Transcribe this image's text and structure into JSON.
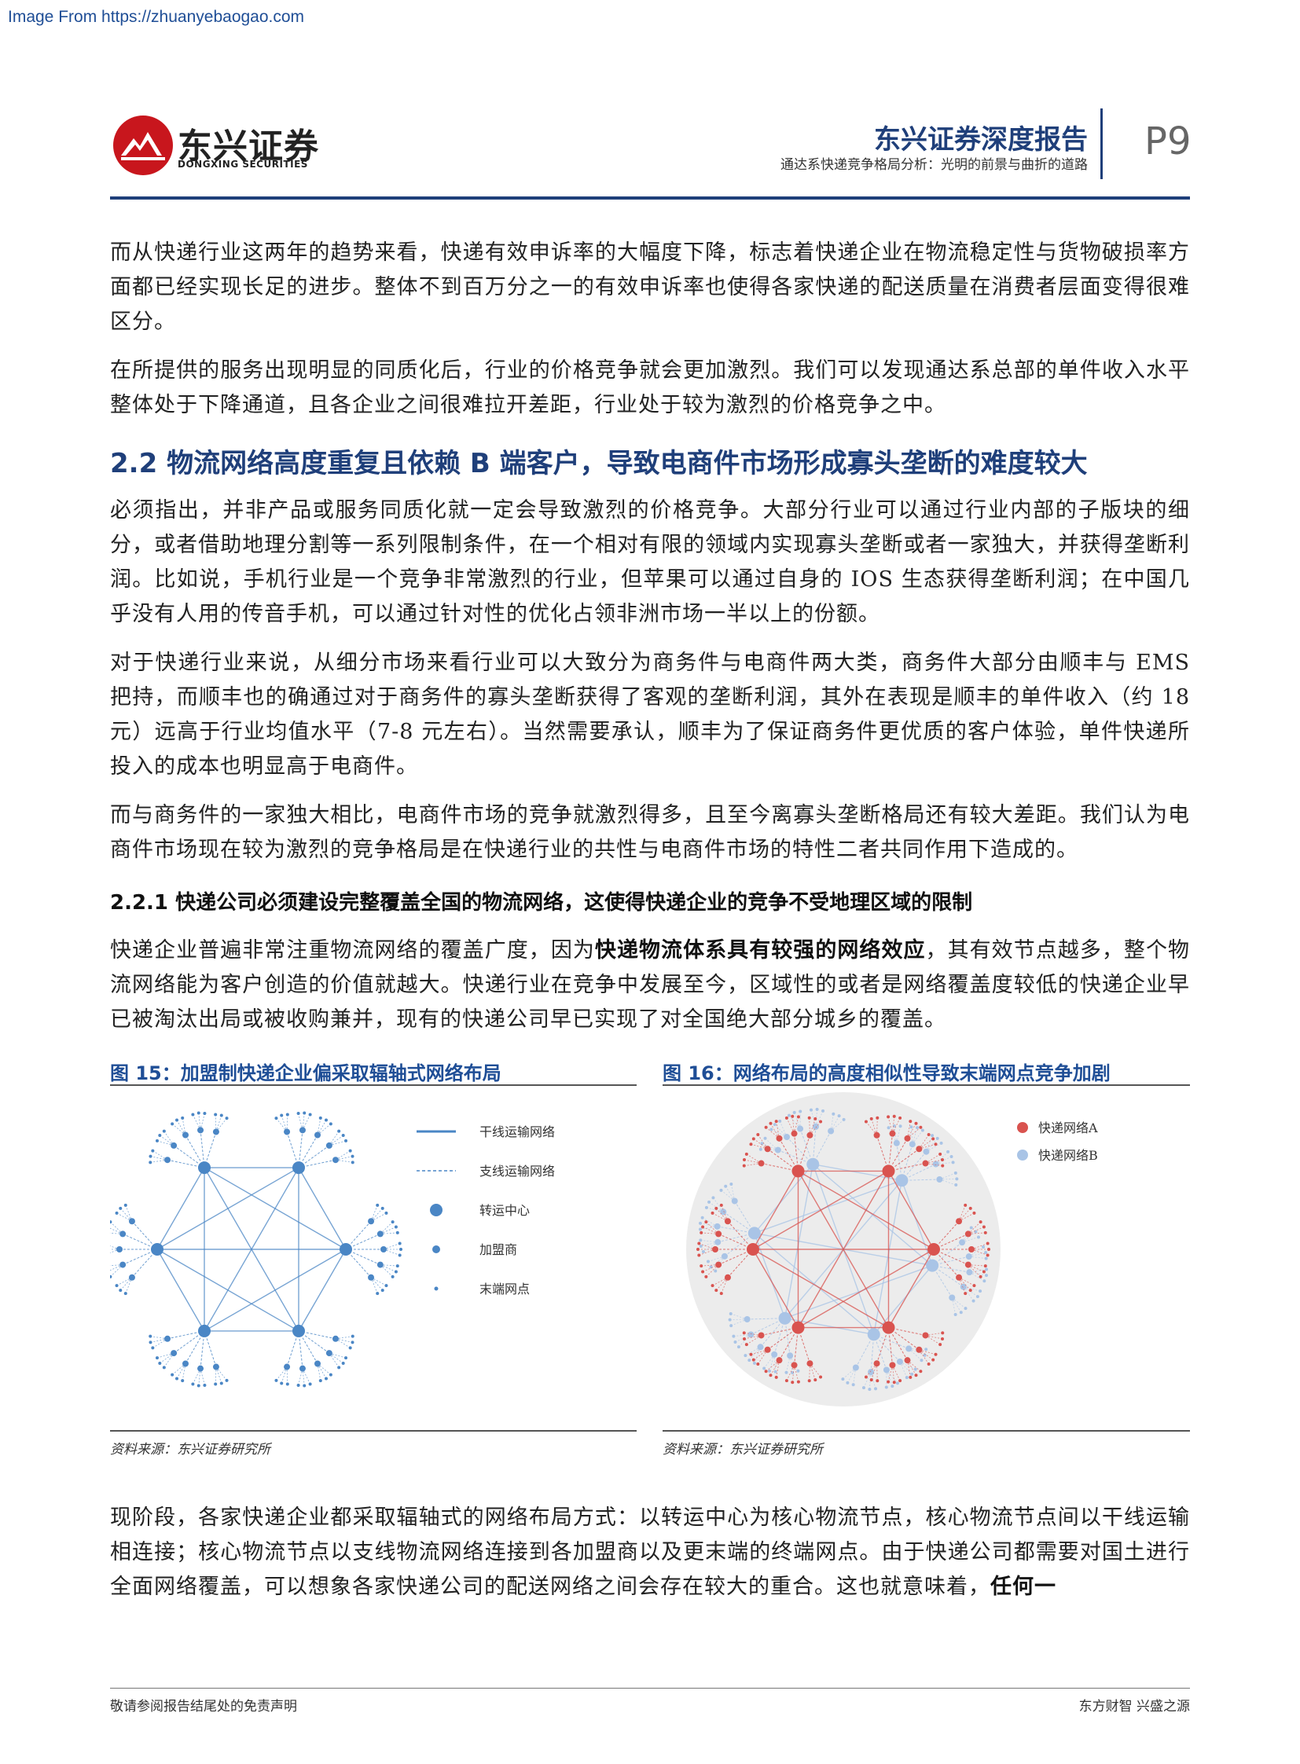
{
  "source_url": "Image From https://zhuanyebaogao.com",
  "header": {
    "logo_cn": "东兴证券",
    "logo_en": "DONGXING SECURITIES",
    "report_title": "东兴证券深度报告",
    "report_subtitle": "通达系快递竞争格局分析：光明的前景与曲折的道路",
    "page": "P9"
  },
  "body": {
    "p1": "而从快递行业这两年的趋势来看，快递有效申诉率的大幅度下降，标志着快递企业在物流稳定性与货物破损率方面都已经实现长足的进步。整体不到百万分之一的有效申诉率也使得各家快递的配送质量在消费者层面变得很难区分。",
    "p2": "在所提供的服务出现明显的同质化后，行业的价格竞争就会更加激烈。我们可以发现通达系总部的单件收入水平整体处于下降通道，且各企业之间很难拉开差距，行业处于较为激烈的价格竞争之中。",
    "h2": "2.2 物流网络高度重复且依赖 B 端客户，导致电商件市场形成寡头垄断的难度较大",
    "p3": "必须指出，并非产品或服务同质化就一定会导致激烈的价格竞争。大部分行业可以通过行业内部的子版块的细分，或者借助地理分割等一系列限制条件，在一个相对有限的领域内实现寡头垄断或者一家独大，并获得垄断利润。比如说，手机行业是一个竞争非常激烈的行业，但苹果可以通过自身的 IOS 生态获得垄断利润；在中国几乎没有人用的传音手机，可以通过针对性的优化占领非洲市场一半以上的份额。",
    "p4": "对于快递行业来说，从细分市场来看行业可以大致分为商务件与电商件两大类，商务件大部分由顺丰与 EMS 把持，而顺丰也的确通过对于商务件的寡头垄断获得了客观的垄断利润，其外在表现是顺丰的单件收入（约 18 元）远高于行业均值水平（7-8 元左右）。当然需要承认，顺丰为了保证商务件更优质的客户体验，单件快递所投入的成本也明显高于电商件。",
    "p5": "而与商务件的一家独大相比，电商件市场的竞争就激烈得多，且至今离寡头垄断格局还有较大差距。我们认为电商件市场现在较为激烈的竞争格局是在快递行业的共性与电商件市场的特性二者共同作用下造成的。",
    "h3": "2.2.1 快递公司必须建设完整覆盖全国的物流网络，这使得快递企业的竞争不受地理区域的限制",
    "p6_a": "快递企业普遍非常注重物流网络的覆盖广度，因为",
    "p6_b": "快递物流体系具有较强的网络效应",
    "p6_c": "，其有效节点越多，整个物流网络能为客户创造的价值就越大。快递行业在竞争中发展至今，区域性的或者是网络覆盖度较低的快递企业早已被淘汰出局或被收购兼并，现有的快递公司早已实现了对全国绝大部分城乡的覆盖。",
    "p7_a": "现阶段，各家快递企业都采取辐轴式的网络布局方式：以转运中心为核心物流节点，核心物流节点间以干线运输相连接；核心物流节点以支线物流网络连接到各加盟商以及更末端的终端网点。由于快递公司都需要对国土进行全面网络覆盖，可以想象各家快递公司的配送网络之间会存在较大的重合。这也就意味着，",
    "p7_b": "任何一"
  },
  "figure15": {
    "title": "图 15：加盟制快递企业偏采取辐轴式网络布局",
    "source": "资料来源：东兴证券研究所",
    "legend": [
      "干线运输网络",
      "支线运输网络",
      "转运中心",
      "加盟商",
      "末端网点"
    ],
    "color": "#4a86c5"
  },
  "figure16": {
    "title": "图 16：网络布局的高度相似性导致末端网点竞争加剧",
    "source": "资料来源：东兴证券研究所",
    "legend": [
      "快递网络A",
      "快递网络B"
    ],
    "color_a": "#d9534f",
    "color_b": "#a9c4e6"
  },
  "footer": {
    "left": "敬请参阅报告结尾处的免责声明",
    "right": "东方财智 兴盛之源"
  },
  "colors": {
    "brand": "#1f3f7a",
    "logo_red": "#c8161d"
  }
}
